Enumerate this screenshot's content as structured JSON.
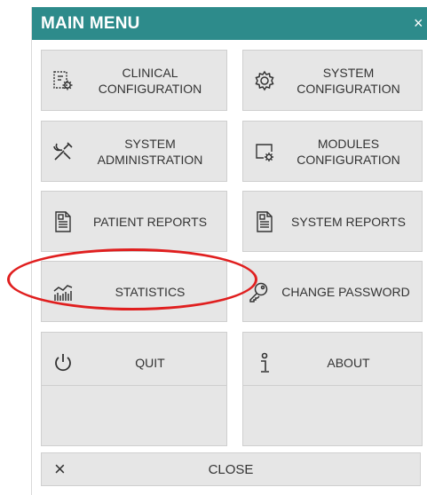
{
  "window": {
    "title": "MAIN MENU",
    "title_close_glyph": "×"
  },
  "menu": {
    "clinical_configuration": [
      "CLINICAL",
      "CONFIGURATION"
    ],
    "system_configuration": [
      "SYSTEM",
      "CONFIGURATION"
    ],
    "system_administration": [
      "SYSTEM",
      "ADMINISTRATION"
    ],
    "modules_configuration": [
      "MODULES",
      "CONFIGURATION"
    ],
    "patient_reports": "PATIENT REPORTS",
    "system_reports": "SYSTEM REPORTS",
    "statistics": "STATISTICS",
    "change_password": "CHANGE PASSWORD",
    "quit": "QUIT",
    "about": "ABOUT"
  },
  "close_bar": {
    "icon": "×",
    "label": "CLOSE"
  },
  "icons": {
    "clinical_configuration": "clipboard-gear-icon",
    "system_configuration": "gear-icon",
    "system_administration": "tools-icon",
    "modules_configuration": "window-gear-icon",
    "patient_reports": "report-icon",
    "system_reports": "report-icon",
    "statistics": "chart-icon",
    "change_password": "key-icon",
    "quit": "power-icon",
    "about": "info-icon"
  },
  "colors": {
    "titlebar": "#2d8b8b",
    "tile": "#e6e6e6",
    "highlight": "#e01f1f"
  }
}
